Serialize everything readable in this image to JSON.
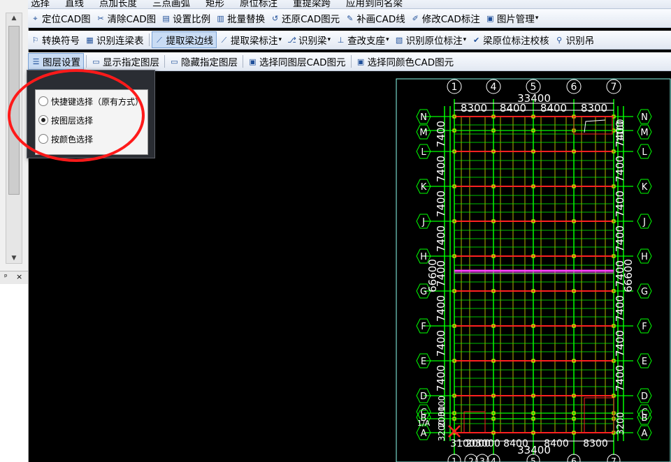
{
  "toolbar": {
    "row0": [
      "选择",
      "直线",
      "点加长度",
      "三点画弧",
      "矩形",
      "原位标注",
      "重提梁跨",
      "应用到同名梁"
    ],
    "row1": [
      {
        "label": "定位CAD图",
        "icon": "locate-icon",
        "glyph": "⌖"
      },
      {
        "label": "清除CAD图",
        "icon": "clear-icon",
        "glyph": "✂"
      },
      {
        "label": "设置比例",
        "icon": "scale-icon",
        "glyph": "▤"
      },
      {
        "label": "批量替换",
        "icon": "replace-icon",
        "glyph": "▥"
      },
      {
        "label": "还原CAD图元",
        "icon": "restore-icon",
        "glyph": "↺"
      },
      {
        "label": "补画CAD线",
        "icon": "draw-line-icon",
        "glyph": "✎"
      },
      {
        "label": "修改CAD标注",
        "icon": "edit-annotation-icon",
        "glyph": "✐"
      },
      {
        "label": "图片管理",
        "icon": "image-icon",
        "glyph": "▣",
        "dropdown": true
      }
    ],
    "row2": [
      {
        "label": "转换符号",
        "icon": "convert-symbol-icon",
        "glyph": "⚐"
      },
      {
        "label": "识别连梁表",
        "icon": "table-icon",
        "glyph": "▦"
      },
      {
        "label": "提取梁边线",
        "icon": "extract-edge-icon",
        "glyph": "⟋",
        "active": true
      },
      {
        "label": "提取梁标注",
        "icon": "extract-label-icon",
        "glyph": "⟋",
        "dropdown": true
      },
      {
        "label": "识别梁",
        "icon": "identify-beam-icon",
        "glyph": "⎇",
        "dropdown": true
      },
      {
        "label": "查改支座",
        "icon": "support-icon",
        "glyph": "⊥",
        "dropdown": true
      },
      {
        "label": "识别原位标注",
        "icon": "inplace-label-icon",
        "glyph": "▧",
        "dropdown": true
      },
      {
        "label": "梁原位标注校核",
        "icon": "check-icon",
        "glyph": "✔"
      },
      {
        "label": "识别吊",
        "icon": "hanger-icon",
        "glyph": "⚲"
      }
    ],
    "row3": [
      {
        "label": "图层设置",
        "icon": "layer-settings-icon",
        "glyph": "☰",
        "active": true
      },
      {
        "label": "显示指定图层",
        "icon": "cad-show-icon",
        "glyph": "▭"
      },
      {
        "label": "隐藏指定图层",
        "icon": "cad-hide-icon",
        "glyph": "▭"
      },
      {
        "label": "选择同图层CAD图元",
        "icon": "cad-select-layer-icon",
        "glyph": "▣"
      },
      {
        "label": "选择同颜色CAD图元",
        "icon": "cad-select-color-icon",
        "glyph": "▣"
      }
    ]
  },
  "panel": {
    "pin": "ᵖ",
    "close": "×"
  },
  "popup": {
    "options": [
      {
        "label": "快捷键选择（原有方式）",
        "selected": false
      },
      {
        "label": "按图层选择",
        "selected": true
      },
      {
        "label": "按颜色选择",
        "selected": false
      }
    ]
  },
  "drawing": {
    "axis_cols": [
      "1",
      "4",
      "5",
      "6",
      "7"
    ],
    "axis_cols_bottom": [
      "1",
      "2",
      "3",
      "4",
      "5",
      "6",
      "7"
    ],
    "axis_rows": [
      "N",
      "M",
      "L",
      "K",
      "J",
      "H",
      "G",
      "F",
      "E",
      "D",
      "C",
      "B",
      "A"
    ],
    "total_width": "33400",
    "bay_widths": [
      "8300",
      "8400",
      "8400",
      "8300"
    ],
    "bottom_widths": [
      "3100",
      "2000",
      "3000",
      "8400",
      "8400",
      "8300"
    ],
    "row_spacing": "7400",
    "total_height": "66600",
    "small_dims_right": [
      "1100",
      "3200"
    ],
    "small_dims_left": [
      "3100",
      "2000",
      "3200"
    ],
    "left_label": "1/A",
    "colors": {
      "grid": "#00ff00",
      "beam": "#ff2020",
      "column": "#ffff00",
      "dim": "#ffffff",
      "dim_alt": "#8dfff0",
      "purple": "#ff40ff"
    }
  }
}
